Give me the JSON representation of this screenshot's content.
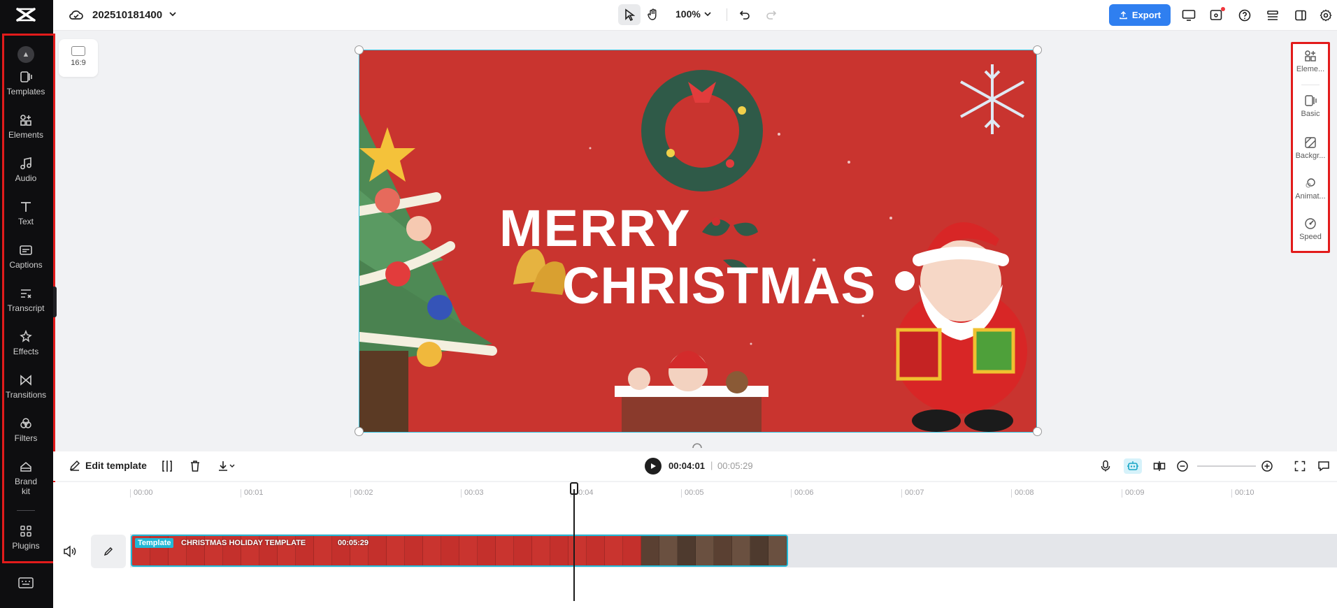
{
  "left_nav": {
    "items": [
      {
        "label": "Templates"
      },
      {
        "label": "Elements"
      },
      {
        "label": "Audio"
      },
      {
        "label": "Text"
      },
      {
        "label": "Captions"
      },
      {
        "label": "Transcript"
      },
      {
        "label": "Effects"
      },
      {
        "label": "Transitions"
      },
      {
        "label": "Filters"
      },
      {
        "label": "Brand kit"
      },
      {
        "label": "Plugins"
      }
    ]
  },
  "header": {
    "project_name": "202510181400",
    "zoom": "100%",
    "export_label": "Export"
  },
  "canvas": {
    "aspect_ratio": "16:9",
    "text_line1": "MERRY",
    "text_line2": "CHRISTMAS",
    "background_color": "#c9342f"
  },
  "right_panel": {
    "items": [
      {
        "label": "Eleme..."
      },
      {
        "label": "Basic"
      },
      {
        "label": "Backgr..."
      },
      {
        "label": "Animat..."
      },
      {
        "label": "Speed"
      }
    ]
  },
  "timeline": {
    "edit_template_label": "Edit template",
    "current_time": "00:04:01",
    "separator": "|",
    "total_time": "00:05:29",
    "ruler_ticks": [
      "00:00",
      "00:01",
      "00:02",
      "00:03",
      "00:04",
      "00:05",
      "00:06",
      "00:07",
      "00:08",
      "00:09",
      "00:10"
    ],
    "clip": {
      "badge": "Template",
      "name": "CHRISTMAS HOLIDAY TEMPLATE",
      "duration": "00:05:29"
    }
  },
  "colors": {
    "accent": "#2f7ff0",
    "selection": "#21b8d6",
    "highlight_outline": "#e21b1b"
  }
}
